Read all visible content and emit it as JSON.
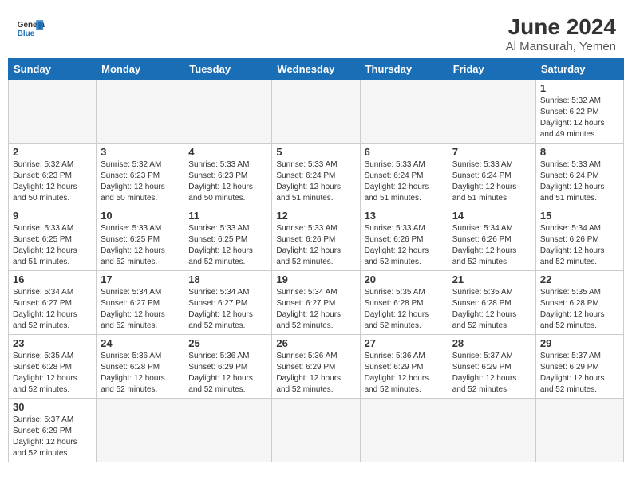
{
  "header": {
    "logo_general": "General",
    "logo_blue": "Blue",
    "month_year": "June 2024",
    "location": "Al Mansurah, Yemen"
  },
  "days_of_week": [
    "Sunday",
    "Monday",
    "Tuesday",
    "Wednesday",
    "Thursday",
    "Friday",
    "Saturday"
  ],
  "weeks": [
    [
      {
        "day": "",
        "empty": true
      },
      {
        "day": "",
        "empty": true
      },
      {
        "day": "",
        "empty": true
      },
      {
        "day": "",
        "empty": true
      },
      {
        "day": "",
        "empty": true
      },
      {
        "day": "",
        "empty": true
      },
      {
        "day": "1",
        "info": "Sunrise: 5:32 AM\nSunset: 6:22 PM\nDaylight: 12 hours\nand 49 minutes."
      }
    ],
    [
      {
        "day": "2",
        "info": "Sunrise: 5:32 AM\nSunset: 6:23 PM\nDaylight: 12 hours\nand 50 minutes."
      },
      {
        "day": "3",
        "info": "Sunrise: 5:32 AM\nSunset: 6:23 PM\nDaylight: 12 hours\nand 50 minutes."
      },
      {
        "day": "4",
        "info": "Sunrise: 5:33 AM\nSunset: 6:23 PM\nDaylight: 12 hours\nand 50 minutes."
      },
      {
        "day": "5",
        "info": "Sunrise: 5:33 AM\nSunset: 6:24 PM\nDaylight: 12 hours\nand 51 minutes."
      },
      {
        "day": "6",
        "info": "Sunrise: 5:33 AM\nSunset: 6:24 PM\nDaylight: 12 hours\nand 51 minutes."
      },
      {
        "day": "7",
        "info": "Sunrise: 5:33 AM\nSunset: 6:24 PM\nDaylight: 12 hours\nand 51 minutes."
      },
      {
        "day": "8",
        "info": "Sunrise: 5:33 AM\nSunset: 6:24 PM\nDaylight: 12 hours\nand 51 minutes."
      }
    ],
    [
      {
        "day": "9",
        "info": "Sunrise: 5:33 AM\nSunset: 6:25 PM\nDaylight: 12 hours\nand 51 minutes."
      },
      {
        "day": "10",
        "info": "Sunrise: 5:33 AM\nSunset: 6:25 PM\nDaylight: 12 hours\nand 52 minutes."
      },
      {
        "day": "11",
        "info": "Sunrise: 5:33 AM\nSunset: 6:25 PM\nDaylight: 12 hours\nand 52 minutes."
      },
      {
        "day": "12",
        "info": "Sunrise: 5:33 AM\nSunset: 6:26 PM\nDaylight: 12 hours\nand 52 minutes."
      },
      {
        "day": "13",
        "info": "Sunrise: 5:33 AM\nSunset: 6:26 PM\nDaylight: 12 hours\nand 52 minutes."
      },
      {
        "day": "14",
        "info": "Sunrise: 5:34 AM\nSunset: 6:26 PM\nDaylight: 12 hours\nand 52 minutes."
      },
      {
        "day": "15",
        "info": "Sunrise: 5:34 AM\nSunset: 6:26 PM\nDaylight: 12 hours\nand 52 minutes."
      }
    ],
    [
      {
        "day": "16",
        "info": "Sunrise: 5:34 AM\nSunset: 6:27 PM\nDaylight: 12 hours\nand 52 minutes."
      },
      {
        "day": "17",
        "info": "Sunrise: 5:34 AM\nSunset: 6:27 PM\nDaylight: 12 hours\nand 52 minutes."
      },
      {
        "day": "18",
        "info": "Sunrise: 5:34 AM\nSunset: 6:27 PM\nDaylight: 12 hours\nand 52 minutes."
      },
      {
        "day": "19",
        "info": "Sunrise: 5:34 AM\nSunset: 6:27 PM\nDaylight: 12 hours\nand 52 minutes."
      },
      {
        "day": "20",
        "info": "Sunrise: 5:35 AM\nSunset: 6:28 PM\nDaylight: 12 hours\nand 52 minutes."
      },
      {
        "day": "21",
        "info": "Sunrise: 5:35 AM\nSunset: 6:28 PM\nDaylight: 12 hours\nand 52 minutes."
      },
      {
        "day": "22",
        "info": "Sunrise: 5:35 AM\nSunset: 6:28 PM\nDaylight: 12 hours\nand 52 minutes."
      }
    ],
    [
      {
        "day": "23",
        "info": "Sunrise: 5:35 AM\nSunset: 6:28 PM\nDaylight: 12 hours\nand 52 minutes."
      },
      {
        "day": "24",
        "info": "Sunrise: 5:36 AM\nSunset: 6:28 PM\nDaylight: 12 hours\nand 52 minutes."
      },
      {
        "day": "25",
        "info": "Sunrise: 5:36 AM\nSunset: 6:29 PM\nDaylight: 12 hours\nand 52 minutes."
      },
      {
        "day": "26",
        "info": "Sunrise: 5:36 AM\nSunset: 6:29 PM\nDaylight: 12 hours\nand 52 minutes."
      },
      {
        "day": "27",
        "info": "Sunrise: 5:36 AM\nSunset: 6:29 PM\nDaylight: 12 hours\nand 52 minutes."
      },
      {
        "day": "28",
        "info": "Sunrise: 5:37 AM\nSunset: 6:29 PM\nDaylight: 12 hours\nand 52 minutes."
      },
      {
        "day": "29",
        "info": "Sunrise: 5:37 AM\nSunset: 6:29 PM\nDaylight: 12 hours\nand 52 minutes."
      }
    ],
    [
      {
        "day": "30",
        "info": "Sunrise: 5:37 AM\nSunset: 6:29 PM\nDaylight: 12 hours\nand 52 minutes."
      },
      {
        "day": "",
        "empty": true
      },
      {
        "day": "",
        "empty": true
      },
      {
        "day": "",
        "empty": true
      },
      {
        "day": "",
        "empty": true
      },
      {
        "day": "",
        "empty": true
      },
      {
        "day": "",
        "empty": true
      }
    ]
  ]
}
